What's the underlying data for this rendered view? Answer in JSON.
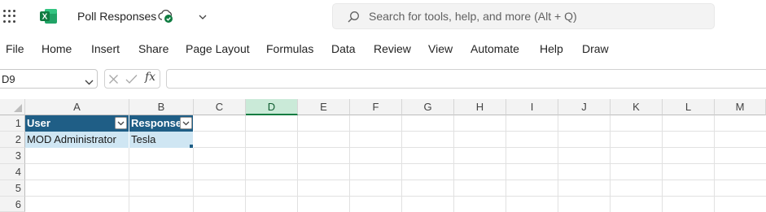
{
  "app": {
    "document_title": "Poll Responses",
    "logo_letter": "X",
    "accent": "#107c41",
    "icons": [
      "app-launcher-icon",
      "excel-logo-icon",
      "cloud-saved-icon",
      "chevron-down-icon",
      "search-icon"
    ]
  },
  "search": {
    "placeholder": "Search for tools, help, and more (Alt + Q)"
  },
  "menu": {
    "items": [
      "File",
      "Home",
      "Insert",
      "Share",
      "Page Layout",
      "Formulas",
      "Data",
      "Review",
      "View",
      "Automate",
      "Help",
      "Draw"
    ]
  },
  "formula_bar": {
    "name_box": "D9",
    "fx_label": "fx",
    "formula_value": ""
  },
  "sheet": {
    "columns": [
      "A",
      "B",
      "C",
      "D",
      "E",
      "F",
      "G",
      "H",
      "I",
      "J",
      "K",
      "L",
      "M"
    ],
    "selected_column": "D",
    "rows": [
      "1",
      "2",
      "3",
      "4",
      "5",
      "6"
    ],
    "table": {
      "header_color": "#1f5e86",
      "band_color": "#cfe6f3",
      "headers": [
        "User",
        "Response"
      ],
      "data": [
        [
          "MOD Administrator",
          "Tesla"
        ]
      ]
    }
  }
}
